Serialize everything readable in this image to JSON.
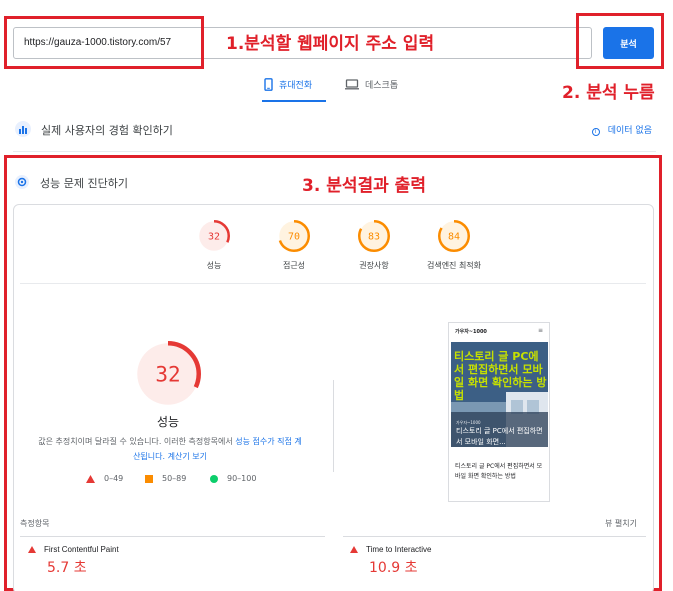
{
  "search": {
    "url_value": "https://gauza-1000.tistory.com/57",
    "analyze_label": "분석"
  },
  "annotations": {
    "step1": "1.분석할 웹페이지 주소 입력",
    "step2": "2. 분석 누름",
    "step3": "3. 분석결과 출력",
    "color": "#e0202a"
  },
  "tabs": {
    "mobile_label": "휴대전화",
    "desktop_label": "데스크톱",
    "active": "mobile"
  },
  "field_data": {
    "title": "실제 사용자의 경험 확인하기",
    "no_data_label": "데이터 없음"
  },
  "diagnosis": {
    "title": "성능 문제 진단하기",
    "scores": [
      {
        "value": "32",
        "label": "성능",
        "color": "#e53935",
        "fill": 0.32
      },
      {
        "value": "70",
        "label": "접근성",
        "color": "#fb8c00",
        "fill": 0.7
      },
      {
        "value": "83",
        "label": "권장사항",
        "color": "#fb8c00",
        "fill": 0.83
      },
      {
        "value": "84",
        "label": "검색엔진 최적화",
        "color": "#fb8c00",
        "fill": 0.84
      }
    ],
    "main_score": {
      "value": "32",
      "label": "성능",
      "fill": 0.32
    },
    "description_prefix": "값은 추정치이며 달라질 수 있습니다. 이러한 측정항목에서 ",
    "description_link": "성능 점수가 직접 계산됩니다.",
    "description_link2": "계산기 보기",
    "legend": [
      {
        "range": "0–49",
        "color": "#e53935",
        "shape": "triangle"
      },
      {
        "range": "50–89",
        "color": "#fb8c00",
        "shape": "square"
      },
      {
        "range": "90–100",
        "color": "#0cce6b",
        "shape": "circle"
      }
    ]
  },
  "preview": {
    "site_name": "가우자~1000",
    "menu_icon": "menu-icon",
    "hero_text": "티스토리 글 PC에서 편집하면서 모바일 화면 확인하는 방법",
    "hero_small": "가우자~1000",
    "hero_caption": "티스토리 글 PC에서 편집하면서 모바일 화면...",
    "post_title": "티스토리 글 PC에서 편집하면서 모바일 화면 확인하는 방법"
  },
  "metrics": {
    "section_label": "측정항목",
    "expand_label": "뷰 펼치기",
    "items": [
      {
        "name": "First Contentful Paint",
        "value": "5.7 초"
      },
      {
        "name": "Time to Interactive",
        "value": "10.9 초"
      }
    ]
  }
}
